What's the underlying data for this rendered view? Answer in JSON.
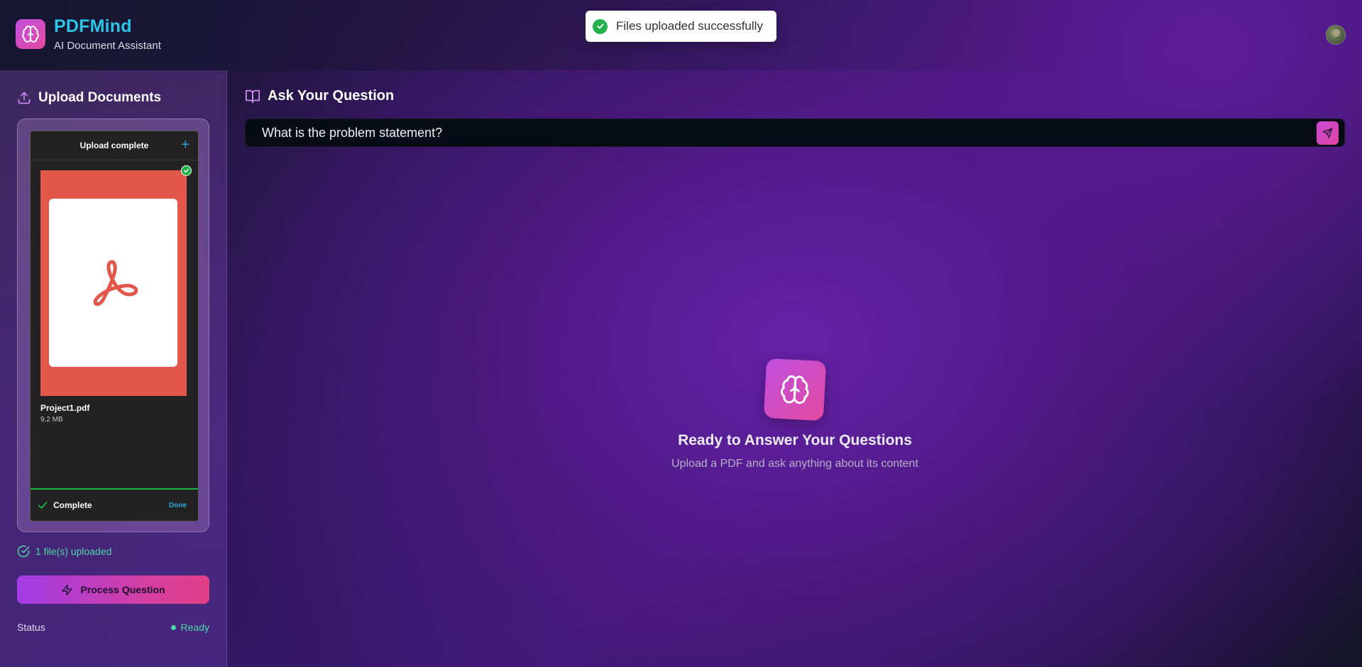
{
  "brand": {
    "name": "PDFMind",
    "subtitle": "AI Document Assistant",
    "icon": "brain-icon"
  },
  "toast": {
    "message": "Files uploaded successfully",
    "icon": "check-circle-icon",
    "color": "#22b24c"
  },
  "sidebar": {
    "title": "Upload Documents",
    "title_icon": "upload-icon",
    "uploader": {
      "header": "Upload complete",
      "add_icon": "plus-icon",
      "file": {
        "name": "Project1.pdf",
        "size": "9.2 MB",
        "icon": "acrobat-icon"
      },
      "footer_status": "Complete",
      "footer_action": "Done"
    },
    "files_status": "1 file(s) uploaded",
    "process_button": "Process Question",
    "status_label": "Status",
    "status_value": "Ready"
  },
  "main": {
    "title": "Ask Your Question",
    "title_icon": "book-open-icon",
    "question_value": "What is the problem statement?",
    "send_icon": "send-icon",
    "empty_title": "Ready to Answer Your Questions",
    "empty_subtitle": "Upload a PDF and ask anything about its content"
  },
  "colors": {
    "accent_cyan": "#2ec4e6",
    "accent_green": "#4ad9a6",
    "gradient_start": "#a23ce6",
    "gradient_end": "#e13f86",
    "pdf_red": "#e2574a"
  }
}
